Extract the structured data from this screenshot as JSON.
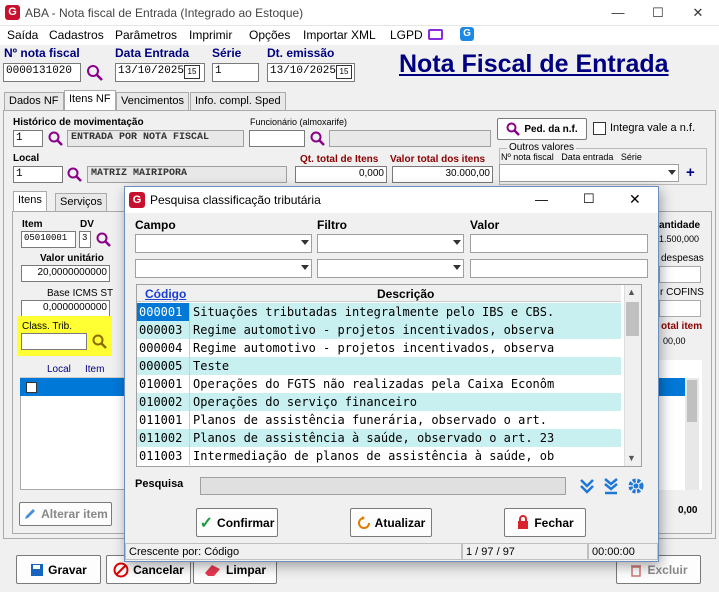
{
  "window": {
    "title": "ABA - Nota fiscal de Entrada (Integrado ao Estoque)",
    "minimize": "—",
    "maximize": "☐",
    "close": "✕"
  },
  "menu": [
    "Saída",
    "Cadastros",
    "Parâmetros",
    "Imprimir",
    "Opções",
    "Importar XML",
    "LGPD"
  ],
  "header": {
    "nota_label": "Nº nota fiscal",
    "nota_value": "0000131020",
    "entrada_label": "Data Entrada",
    "entrada_value": "13/10/2025",
    "serie_label": "Série",
    "serie_value": "1",
    "emissao_label": "Dt. emissão",
    "emissao_value": "13/10/2025",
    "big_title": "Nota Fiscal de Entrada",
    "cal": "15"
  },
  "main_tabs": [
    "Dados NF",
    "Itens NF",
    "Vencimentos",
    "Info. compl. Sped"
  ],
  "form": {
    "hist_label": "Histórico de movimentação",
    "hist_code": "1",
    "hist_desc": "ENTRADA POR NOTA FISCAL",
    "func_label": "Funcionário (almoxarife)",
    "func_code": "",
    "ped_button": "Ped. da n.f.",
    "integra_label": "Integra vale a n.f.",
    "outros_label": "Outros valores",
    "outros_cols": "Nº nota fiscal   Data entrada   Série",
    "local_label": "Local",
    "local_code": "1",
    "local_desc": "MATRIZ MAIRIPORA",
    "qt_label": "Qt. total de Itens",
    "qt_value": "0,000",
    "vt_label": "Valor total dos itens",
    "vt_value": "30.000,00",
    "plus": "+"
  },
  "sub_tabs": [
    "Itens",
    "Serviços"
  ],
  "items": {
    "item_label": "Item",
    "item_value": "05010001",
    "dv_label": "DV",
    "dv_value": "3",
    "vu_label": "Valor unitário",
    "vu_value": "20,0000000000",
    "bicms_label": "Base ICMS ST",
    "bicms_value": "0,0000000000",
    "class_label": "Class. Trib.",
    "class_value": "",
    "list_cols": [
      "Local",
      "Item"
    ],
    "alterar": "Alterar item",
    "right_quant": "antidade",
    "right_quant_val": "1.500,000",
    "right_desp": "despesas",
    "right_cofins": "r COFINS",
    "right_total": "otal item",
    "right_total_val": "00,00",
    "right_zero": "0,00"
  },
  "bottom": {
    "gravar": "Gravar",
    "cancelar": "Cancelar",
    "limpar": "Limpar",
    "excluir": "Excluir"
  },
  "dialog": {
    "title": "Pesquisa classificação tributária",
    "campo_label": "Campo",
    "filtro_label": "Filtro",
    "valor_label": "Valor",
    "col_codigo": "Código",
    "col_descricao": "Descrição",
    "rows": [
      {
        "c": "000001",
        "d": "Situações tributadas integralmente pelo IBS e CBS."
      },
      {
        "c": "000003",
        "d": "Regime automotivo - projetos incentivados, observa"
      },
      {
        "c": "000004",
        "d": "Regime automotivo - projetos incentivados, observa"
      },
      {
        "c": "000005",
        "d": "Teste"
      },
      {
        "c": "010001",
        "d": "Operações do FGTS não realizadas pela Caixa Econôm"
      },
      {
        "c": "010002",
        "d": "Operações do serviço financeiro"
      },
      {
        "c": "011001",
        "d": "Planos de assistência funerária, observado o art. "
      },
      {
        "c": "011002",
        "d": "Planos de assistência à saúde, observado o art. 23"
      },
      {
        "c": "011003",
        "d": "Intermediação de planos de assistência à saúde, ob"
      }
    ],
    "pesquisa_label": "Pesquisa",
    "confirmar": "Confirmar",
    "atualizar": "Atualizar",
    "fechar": "Fechar",
    "status_order": "Crescente por: Código",
    "status_count": "1 / 97 / 97",
    "status_time": "00:00:00"
  },
  "colors": {
    "accent": "#1a3fd6",
    "selected": "#0078d7",
    "rowalt": "#c8f0f0",
    "brand": "#c8102e"
  }
}
